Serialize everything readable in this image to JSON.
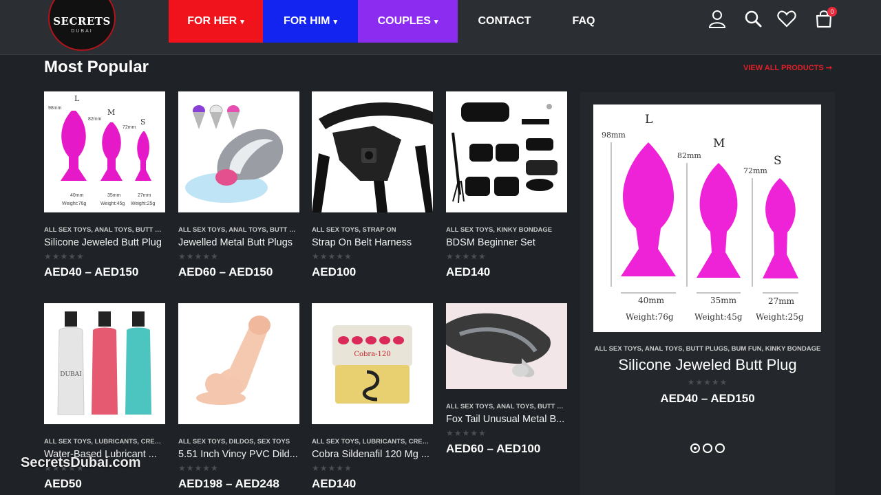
{
  "logo": {
    "name": "SECRETS",
    "sub": "DUBAI"
  },
  "nav": {
    "for_her": "FOR HER",
    "for_him": "FOR HIM",
    "couples": "COUPLES",
    "contact": "CONTACT",
    "faq": "FAQ",
    "chevron": "⌄"
  },
  "header_icons": [
    "user-icon",
    "search-icon",
    "heart-icon",
    "cart-icon"
  ],
  "cart_count": "0",
  "section": {
    "title": "Most Popular",
    "view_all": "VIEW ALL PRODUCTS ➞"
  },
  "stars": "★★★★★",
  "products": [
    {
      "cats": "ALL SEX TOYS, ANAL TOYS, BUTT PLU...",
      "name": "Silicone Jeweled Butt Plug",
      "price": "AED40 – AED150"
    },
    {
      "cats": "ALL SEX TOYS, ANAL TOYS, BUTT PLU...",
      "name": "Jewelled Metal Butt Plugs",
      "price": "AED60 – AED150"
    },
    {
      "cats": "ALL SEX TOYS, STRAP ON",
      "name": "Strap On Belt Harness",
      "price": "AED100"
    },
    {
      "cats": "ALL SEX TOYS, KINKY BONDAGE",
      "name": "BDSM Beginner Set",
      "price": "AED140"
    },
    {
      "cats": "ALL SEX TOYS, LUBRICANTS, CREAMS...",
      "name": "Water-Based Lubricant ...",
      "price": "AED50"
    },
    {
      "cats": "ALL SEX TOYS, DILDOS, SEX TOYS",
      "name": "5.51 Inch Vincy PVC Dild...",
      "price": "AED198 – AED248"
    },
    {
      "cats": "ALL SEX TOYS, LUBRICANTS, CREAMS...",
      "name": "Cobra Sildenafil 120 Mg ...",
      "price": "AED140"
    },
    {
      "cats": "ALL SEX TOYS, ANAL TOYS, BUTT PLU...",
      "name": "Fox Tail Unusual Metal B...",
      "price": "AED60 – AED100"
    }
  ],
  "featured": {
    "cats": "ALL SEX TOYS, ANAL TOYS, BUTT PLUGS, BUM FUN, KINKY BONDAGE",
    "name": "Silicone Jeweled Butt Plug",
    "price": "AED40 – AED150",
    "image_labels": {
      "L": "L",
      "M": "M",
      "S": "S",
      "h1": "98mm",
      "h2": "82mm",
      "h3": "72mm",
      "w1": "40mm",
      "w2": "35mm",
      "w3": "27mm",
      "wt1": "Weight:76g",
      "wt2": "Weight:45g",
      "wt3": "Weight:25g"
    },
    "slider_pages": 3,
    "slider_active": 1
  },
  "cobra_label": "Cobra-120",
  "lube_brand": "DUBAI",
  "watermark": "SecretsDubai.com"
}
